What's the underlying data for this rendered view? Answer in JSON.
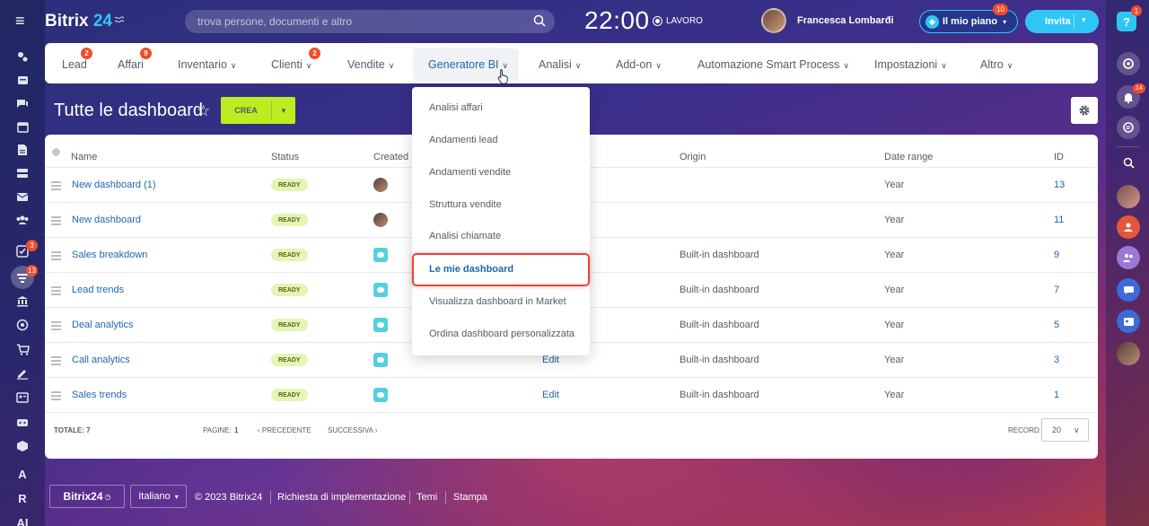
{
  "header": {
    "logo_text": "Bitrix",
    "logo_num": "24",
    "search_placeholder": "trova persone, documenti e altro",
    "clock": "22:00",
    "work_status": "LAVORO",
    "user_name": "Francesca Lombardi",
    "plan_label": "Il mio piano",
    "plan_badge": "10",
    "invite_label": "Invita"
  },
  "left_sidebar": {
    "badges": {
      "tasks": "3",
      "pipeline": "13"
    },
    "letters": [
      "A",
      "R",
      "AI"
    ]
  },
  "right_sidebar": {
    "help_label": "?",
    "help_badge": "1",
    "notifications_badge": "14"
  },
  "nav": {
    "items": [
      {
        "label": "Lead",
        "badge": "2"
      },
      {
        "label": "Affari",
        "badge": "9"
      },
      {
        "label": "Inventario"
      },
      {
        "label": "Clienti",
        "badge": "2"
      },
      {
        "label": "Vendite"
      },
      {
        "label": "Generatore BI",
        "active": true
      },
      {
        "label": "Analisi"
      },
      {
        "label": "Add-on"
      },
      {
        "label": "Automazione Smart Process"
      },
      {
        "label": "Impostazioni"
      },
      {
        "label": "Altro"
      }
    ]
  },
  "page": {
    "title": "Tutte le dashboard",
    "create_label": "CREA"
  },
  "table": {
    "columns": [
      "Name",
      "Status",
      "Created by",
      "",
      "Origin",
      "Date range",
      "ID"
    ],
    "rows": [
      {
        "name": "New dashboard (1)",
        "status": "READY",
        "creator": "user",
        "edit": "",
        "origin": "",
        "range": "Year",
        "id": "13"
      },
      {
        "name": "New dashboard",
        "status": "READY",
        "creator": "user",
        "edit": "",
        "origin": "",
        "range": "Year",
        "id": "11"
      },
      {
        "name": "Sales breakdown",
        "status": "READY",
        "creator": "market",
        "edit": "",
        "origin": "Built-in dashboard",
        "range": "Year",
        "id": "9"
      },
      {
        "name": "Lead trends",
        "status": "READY",
        "creator": "market",
        "edit": "",
        "origin": "Built-in dashboard",
        "range": "Year",
        "id": "7"
      },
      {
        "name": "Deal analytics",
        "status": "READY",
        "creator": "market",
        "edit": "",
        "origin": "Built-in dashboard",
        "range": "Year",
        "id": "5"
      },
      {
        "name": "Call analytics",
        "status": "READY",
        "creator": "market",
        "edit": "Edit",
        "origin": "Built-in dashboard",
        "range": "Year",
        "id": "3"
      },
      {
        "name": "Sales trends",
        "status": "READY",
        "creator": "market",
        "edit": "Edit",
        "origin": "Built-in dashboard",
        "range": "Year",
        "id": "1"
      }
    ],
    "footer": {
      "total_label": "TOTALE: 7",
      "pages_label": "PAGINE:",
      "pages_value": "1",
      "prev_label": "PRECEDENTE",
      "next_label": "SUCCESSIVA",
      "record_label": "RECORD:",
      "record_value": "20"
    }
  },
  "dropdown": {
    "items": [
      {
        "label": "Analisi affari"
      },
      {
        "label": "Andamenti lead"
      },
      {
        "label": "Andamenti vendite"
      },
      {
        "label": "Struttura vendite"
      },
      {
        "label": "Analisi chiamate"
      },
      {
        "label": "Le mie dashboard",
        "selected": true
      },
      {
        "label": "Visualizza dashboard in Market"
      },
      {
        "label": "Ordina dashboard personalizzata"
      }
    ]
  },
  "footer": {
    "logo": "Bitrix24",
    "language": "Italiano",
    "copyright": "© 2023 Bitrix24",
    "links": [
      "Richiesta di implementazione",
      "Temi",
      "Stampa"
    ]
  },
  "colors": {
    "accent": "#2fc6f6",
    "link": "#2067b0",
    "create_button": "#bbed21",
    "badge": "#f04d2c",
    "highlight": "#e5443a"
  }
}
